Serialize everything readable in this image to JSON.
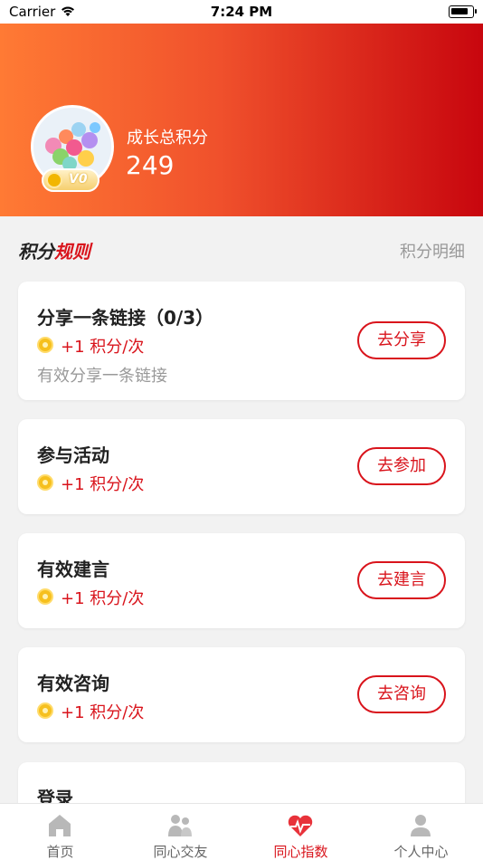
{
  "status_bar": {
    "carrier": "Carrier",
    "time": "7:24 PM"
  },
  "profile": {
    "level": "V0",
    "points_label": "成长总积分",
    "points_value": "249"
  },
  "rules": {
    "title_part1": "积分",
    "title_part2": "规则",
    "detail_link": "积分明细"
  },
  "tasks": [
    {
      "title": "分享一条链接（0/3）",
      "reward": "+1 积分/次",
      "description": "有效分享一条链接",
      "button": "去分享"
    },
    {
      "title": "参与活动",
      "reward": "+1 积分/次",
      "button": "去参加"
    },
    {
      "title": "有效建言",
      "reward": "+1 积分/次",
      "button": "去建言"
    },
    {
      "title": "有效咨询",
      "reward": "+1 积分/次",
      "button": "去咨询"
    },
    {
      "title": "登录"
    }
  ],
  "tabs": [
    {
      "label": "首页",
      "icon": "home-icon",
      "active": false
    },
    {
      "label": "同心交友",
      "icon": "friends-icon",
      "active": false
    },
    {
      "label": "同心指数",
      "icon": "heart-index-icon",
      "active": true
    },
    {
      "label": "个人中心",
      "icon": "person-icon",
      "active": false
    }
  ],
  "colors": {
    "accent": "#d9141c",
    "gradient_start": "#ff7a34",
    "gradient_end": "#c8060e",
    "inactive_tab": "#b8b8b8"
  }
}
